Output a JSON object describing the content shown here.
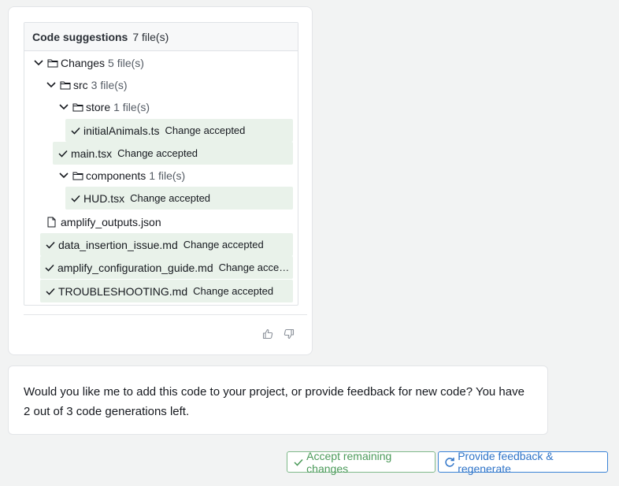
{
  "code_suggestions": {
    "title": "Code suggestions",
    "count": "7 file(s)"
  },
  "tree": {
    "changes": {
      "name": "Changes",
      "count": "5 file(s)"
    },
    "src": {
      "name": "src",
      "count": "3 file(s)"
    },
    "store": {
      "name": "store",
      "count": "1 file(s)"
    },
    "initialAnimals": {
      "name": "initialAnimals.ts",
      "status": "Change accepted"
    },
    "main": {
      "name": "main.tsx",
      "status": "Change accepted"
    },
    "components": {
      "name": "components",
      "count": "1 file(s)"
    },
    "hud": {
      "name": "HUD.tsx",
      "status": "Change accepted"
    },
    "amplify_outputs": {
      "name": "amplify_outputs.json"
    },
    "data_insertion": {
      "name": "data_insertion_issue.md",
      "status": "Change accepted"
    },
    "amplify_config": {
      "name": "amplify_configuration_guide.md",
      "status": "Change accepted"
    },
    "troubleshooting": {
      "name": "TROUBLESHOOTING.md",
      "status": "Change accepted"
    }
  },
  "message": {
    "text": "Would you like me to add this code to your project, or provide feedback for new code? You have 2 out of 3 code generations left."
  },
  "actions": {
    "accept_label": "Accept remaining changes",
    "feedback_label": "Provide feedback & regenerate"
  },
  "icons": {
    "chevron": "chevron-down-icon",
    "folder": "folder-icon",
    "file": "file-icon",
    "check": "check-icon",
    "thumbs_up": "thumbs-up-icon",
    "thumbs_down": "thumbs-down-icon",
    "refresh": "refresh-icon"
  },
  "colors": {
    "accepted_bg": "#e9f2ea",
    "accept_green": "#4b9a5a",
    "feedback_blue": "#2f74c8"
  }
}
